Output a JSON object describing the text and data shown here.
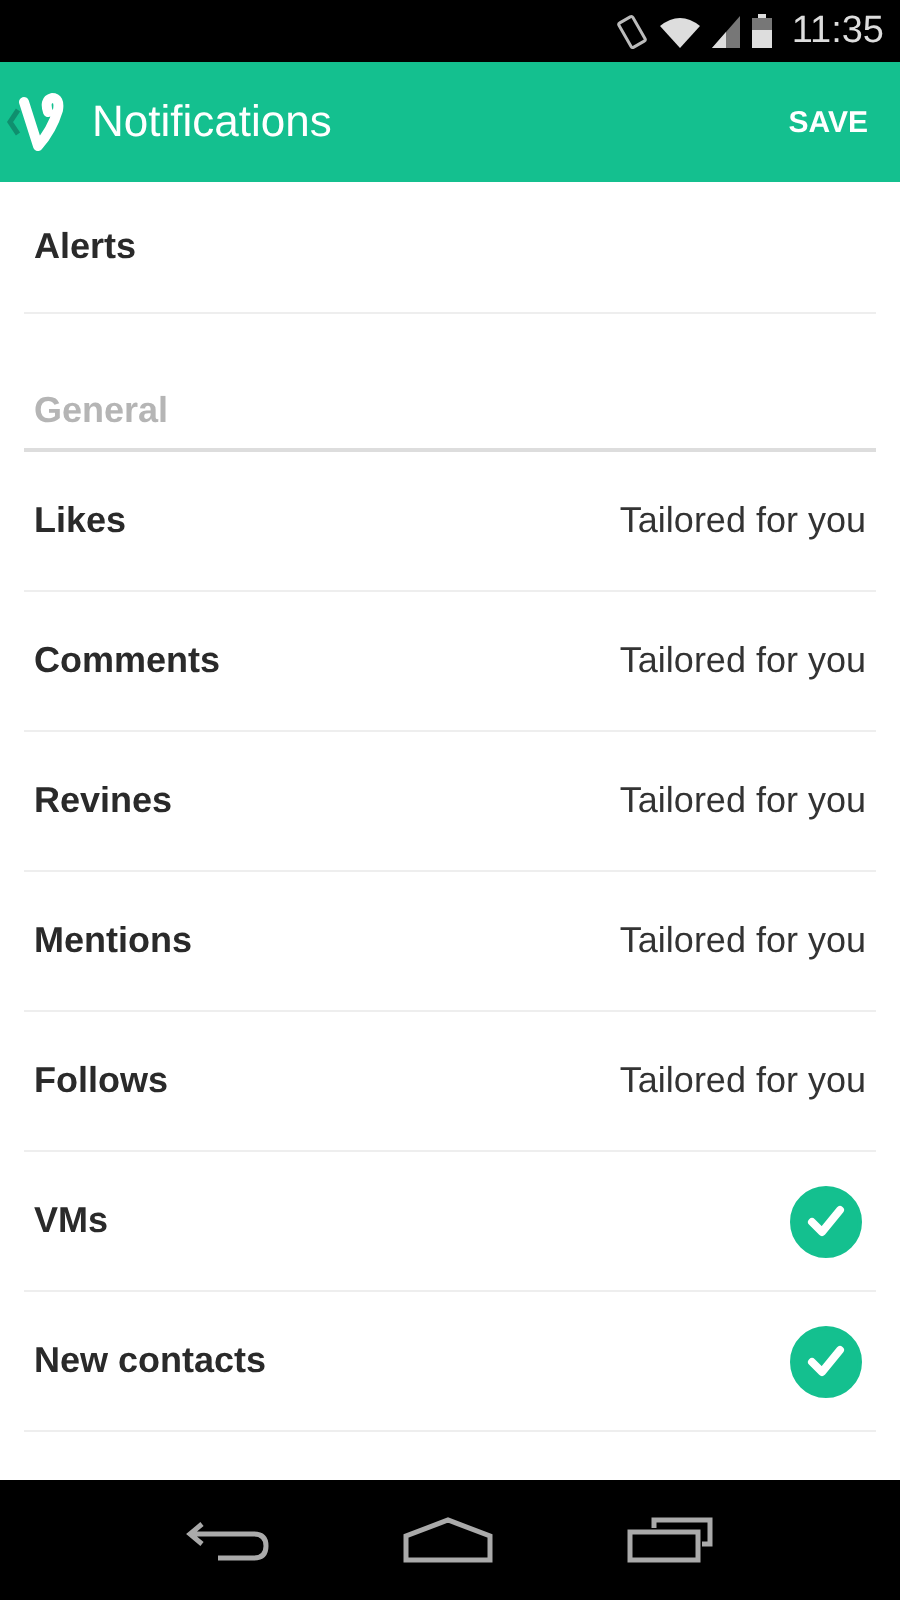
{
  "status_bar": {
    "time": "11:35"
  },
  "app_bar": {
    "title": "Notifications",
    "action": "SAVE"
  },
  "top_item": {
    "label": "Alerts"
  },
  "section": {
    "title": "General"
  },
  "rows": [
    {
      "kind": "choice",
      "label": "Likes",
      "value": "Tailored for you"
    },
    {
      "kind": "choice",
      "label": "Comments",
      "value": "Tailored for you"
    },
    {
      "kind": "choice",
      "label": "Revines",
      "value": "Tailored for you"
    },
    {
      "kind": "choice",
      "label": "Mentions",
      "value": "Tailored for you"
    },
    {
      "kind": "choice",
      "label": "Follows",
      "value": "Tailored for you"
    },
    {
      "kind": "check",
      "label": "VMs",
      "checked": true
    },
    {
      "kind": "check",
      "label": "New contacts",
      "checked": true
    }
  ]
}
